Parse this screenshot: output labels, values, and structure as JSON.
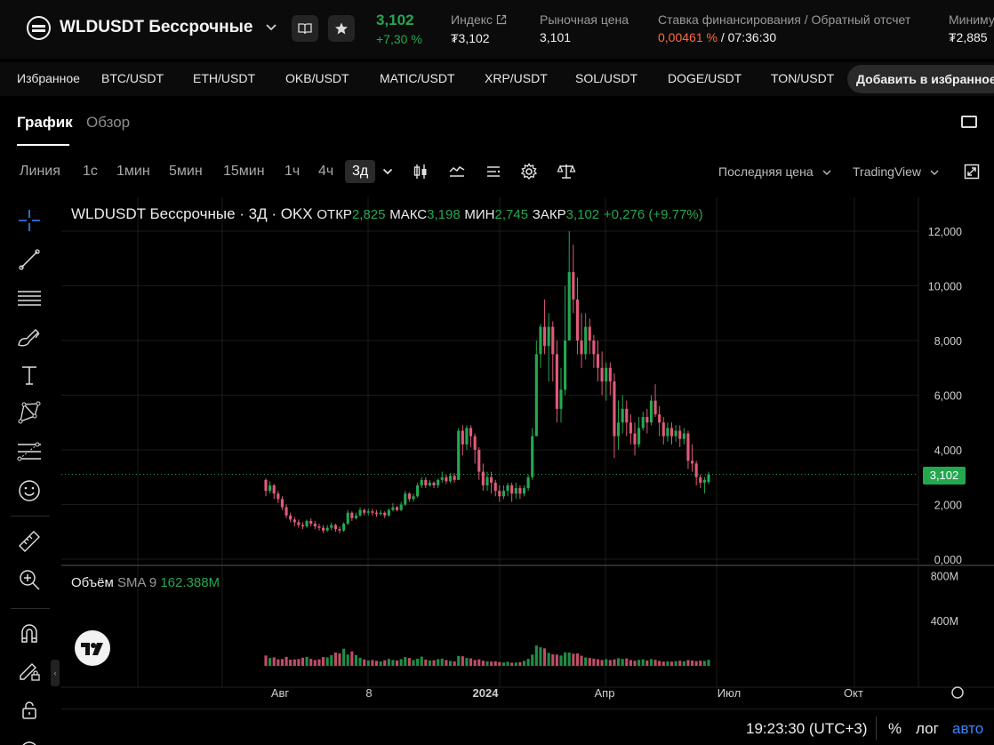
{
  "header": {
    "symbol": "WLDUSDT Бессрочные",
    "price": "3,102",
    "change": "+7,30 %",
    "index_label": "Индекс",
    "index_value": "₮3,102",
    "mark_label": "Рыночная цена",
    "mark_value": "3,101",
    "funding_label": "Ставка финансирования / Обратный отсчет",
    "funding_rate": "0,00461 %",
    "funding_sep": " / ",
    "funding_countdown": "07:36:30",
    "min_label": "Миниму",
    "min_value": "₮2,885"
  },
  "favorites": {
    "label": "Избранное",
    "items": [
      "BTC/USDT",
      "ETH/USDT",
      "OKB/USDT",
      "MATIC/USDT",
      "XRP/USDT",
      "SOL/USDT",
      "DOGE/USDT",
      "TON/USDT"
    ],
    "add_label": "Добавить в избранное"
  },
  "tabs": {
    "chart": "График",
    "overview": "Обзор"
  },
  "toolbar": {
    "timeframes": [
      "Линия",
      "1с",
      "1мин",
      "5мин",
      "15мин",
      "1ч",
      "4ч"
    ],
    "active_timeframe": "3д",
    "price_type": "Последняя цена",
    "source": "TradingView"
  },
  "legend": {
    "title": "WLDUSDT Бессрочные · 3Д · OKX",
    "open_label": "ОТКР",
    "open": "2,825",
    "high_label": "МАКС",
    "high": "3,198",
    "low_label": "МИН",
    "low": "2,745",
    "close_label": "ЗАКР",
    "close": "3,102",
    "change": "+0,276 (+9.77%)"
  },
  "volume": {
    "title": "Объём",
    "sma": "SMA 9",
    "value": "162.388M"
  },
  "axes": {
    "price_ticks": [
      "12,000",
      "10,000",
      "8,000",
      "6,000",
      "4,000",
      "2,000",
      "0,000"
    ],
    "volume_ticks": [
      "800M",
      "400M"
    ],
    "time_ticks": [
      "Авг",
      "8",
      "2024",
      "Апр",
      "Июл",
      "Окт"
    ],
    "last_price": "3,102"
  },
  "footer": {
    "time": "19:23:30 (UTC+3)",
    "percent": "%",
    "log": "лог",
    "auto": "авто"
  },
  "colors": {
    "up": "#25a750",
    "down": "#e05a7a",
    "accent": "#3a86ff",
    "funding": "#ff6a3d"
  },
  "chart_data": {
    "type": "candlestick",
    "title": "WLDUSDT Бессрочные · 3Д · OKX",
    "ylim": [
      0,
      12
    ],
    "volume_ylim": [
      0,
      1000
    ],
    "candles": [
      [
        2.9,
        2.5,
        2.95,
        2.3,
        92
      ],
      [
        2.5,
        2.7,
        2.85,
        2.4,
        70
      ],
      [
        2.7,
        2.4,
        2.75,
        2.2,
        75
      ],
      [
        2.4,
        2.2,
        2.5,
        2.05,
        58
      ],
      [
        2.2,
        1.9,
        2.3,
        1.8,
        60
      ],
      [
        1.9,
        1.6,
        2.0,
        1.5,
        80
      ],
      [
        1.6,
        1.45,
        1.7,
        1.35,
        55
      ],
      [
        1.45,
        1.35,
        1.55,
        1.2,
        57
      ],
      [
        1.35,
        1.25,
        1.45,
        1.15,
        60
      ],
      [
        1.25,
        1.2,
        1.35,
        1.1,
        72
      ],
      [
        1.2,
        1.4,
        1.45,
        1.15,
        80
      ],
      [
        1.4,
        1.3,
        1.5,
        1.2,
        62
      ],
      [
        1.3,
        1.2,
        1.4,
        1.1,
        52
      ],
      [
        1.2,
        1.15,
        1.3,
        1.05,
        58
      ],
      [
        1.15,
        1.05,
        1.25,
        0.95,
        78
      ],
      [
        1.05,
        1.15,
        1.25,
        1.0,
        75
      ],
      [
        1.15,
        1.25,
        1.35,
        1.05,
        95
      ],
      [
        1.25,
        1.1,
        1.3,
        1.0,
        118
      ],
      [
        1.1,
        1.05,
        1.2,
        0.95,
        110
      ],
      [
        1.05,
        1.3,
        1.35,
        1.0,
        152
      ],
      [
        1.3,
        1.7,
        1.8,
        1.25,
        100
      ],
      [
        1.7,
        1.5,
        1.75,
        1.4,
        128
      ],
      [
        1.5,
        1.6,
        1.7,
        1.45,
        96
      ],
      [
        1.6,
        1.8,
        1.9,
        1.55,
        72
      ],
      [
        1.8,
        1.7,
        1.85,
        1.6,
        57
      ],
      [
        1.7,
        1.75,
        1.85,
        1.6,
        48
      ],
      [
        1.75,
        1.7,
        1.85,
        1.6,
        52
      ],
      [
        1.7,
        1.65,
        1.8,
        1.55,
        45
      ],
      [
        1.65,
        1.7,
        1.8,
        1.6,
        40
      ],
      [
        1.7,
        1.6,
        1.75,
        1.5,
        50
      ],
      [
        1.6,
        1.8,
        1.85,
        1.55,
        62
      ],
      [
        1.8,
        1.9,
        2.05,
        1.75,
        52
      ],
      [
        1.9,
        1.8,
        1.95,
        1.75,
        48
      ],
      [
        1.8,
        2.0,
        2.1,
        1.75,
        60
      ],
      [
        2.0,
        2.4,
        2.5,
        1.95,
        78
      ],
      [
        2.4,
        2.2,
        2.45,
        2.1,
        70
      ],
      [
        2.2,
        2.3,
        2.4,
        2.1,
        52
      ],
      [
        2.3,
        2.7,
        2.8,
        2.25,
        64
      ],
      [
        2.7,
        2.9,
        3.0,
        2.6,
        82
      ],
      [
        2.9,
        2.7,
        3.0,
        2.6,
        55
      ],
      [
        2.7,
        2.8,
        2.9,
        2.65,
        48
      ],
      [
        2.8,
        2.7,
        2.85,
        2.6,
        50
      ],
      [
        2.7,
        2.9,
        2.95,
        2.6,
        60
      ],
      [
        2.9,
        3.0,
        3.2,
        2.8,
        64
      ],
      [
        3.0,
        2.85,
        3.1,
        2.75,
        52
      ],
      [
        2.85,
        3.05,
        3.15,
        2.8,
        45
      ],
      [
        3.05,
        2.9,
        3.15,
        2.8,
        40
      ],
      [
        2.9,
        4.7,
        4.8,
        2.9,
        88
      ],
      [
        4.7,
        4.2,
        4.9,
        3.8,
        85
      ],
      [
        4.2,
        4.8,
        4.9,
        4.0,
        70
      ],
      [
        4.8,
        4.5,
        4.9,
        4.1,
        66
      ],
      [
        4.5,
        4.0,
        4.6,
        3.5,
        52
      ],
      [
        4.0,
        3.2,
        4.1,
        2.9,
        58
      ],
      [
        3.2,
        2.7,
        3.5,
        2.5,
        46
      ],
      [
        2.7,
        3.0,
        3.2,
        2.5,
        40
      ],
      [
        3.0,
        2.8,
        3.2,
        2.4,
        38
      ],
      [
        2.8,
        2.5,
        2.9,
        2.3,
        40
      ],
      [
        2.5,
        2.3,
        2.7,
        2.1,
        34
      ],
      [
        2.3,
        2.5,
        2.7,
        2.2,
        30
      ],
      [
        2.5,
        2.7,
        2.8,
        2.3,
        36
      ],
      [
        2.7,
        2.4,
        2.8,
        2.1,
        28
      ],
      [
        2.4,
        2.6,
        2.8,
        2.2,
        30
      ],
      [
        2.6,
        2.4,
        2.7,
        2.2,
        34
      ],
      [
        2.4,
        2.6,
        2.7,
        2.3,
        45
      ],
      [
        2.6,
        3.0,
        3.1,
        2.5,
        62
      ],
      [
        3.0,
        4.5,
        4.8,
        2.9,
        100
      ],
      [
        4.5,
        7.5,
        8.0,
        4.5,
        180
      ],
      [
        7.5,
        8.5,
        8.6,
        7.0,
        165
      ],
      [
        8.5,
        7.8,
        9.5,
        7.5,
        155
      ],
      [
        7.8,
        8.5,
        9.0,
        6.5,
        115
      ],
      [
        8.5,
        7.5,
        8.7,
        6.5,
        102
      ],
      [
        7.5,
        5.5,
        8.0,
        5.0,
        100
      ],
      [
        5.5,
        6.2,
        7.0,
        5.0,
        92
      ],
      [
        6.2,
        8.0,
        10.0,
        6.0,
        120
      ],
      [
        8.0,
        10.5,
        12.0,
        8.0,
        118
      ],
      [
        10.5,
        9.5,
        11.5,
        9.0,
        108
      ],
      [
        9.5,
        8.0,
        10.3,
        7.5,
        110
      ],
      [
        8.0,
        7.5,
        9.0,
        7.0,
        90
      ],
      [
        7.5,
        8.5,
        9.0,
        7.3,
        75
      ],
      [
        8.5,
        8.0,
        8.8,
        7.5,
        70
      ],
      [
        8.0,
        7.5,
        8.2,
        7.0,
        64
      ],
      [
        7.5,
        7.0,
        8.0,
        6.5,
        58
      ],
      [
        7.0,
        6.5,
        7.6,
        6.0,
        52
      ],
      [
        6.5,
        7.0,
        7.2,
        5.8,
        60
      ],
      [
        7.0,
        6.5,
        7.2,
        6.0,
        52
      ],
      [
        6.5,
        4.5,
        6.8,
        3.7,
        58
      ],
      [
        4.5,
        5.0,
        5.8,
        4.0,
        68
      ],
      [
        5.0,
        5.5,
        6.0,
        4.6,
        62
      ],
      [
        5.5,
        5.0,
        5.8,
        4.5,
        66
      ],
      [
        5.0,
        4.6,
        5.3,
        4.2,
        52
      ],
      [
        4.6,
        4.2,
        5.0,
        3.8,
        46
      ],
      [
        4.2,
        4.8,
        5.2,
        4.1,
        54
      ],
      [
        4.8,
        5.2,
        5.4,
        4.7,
        58
      ],
      [
        5.2,
        5.0,
        5.5,
        4.6,
        48
      ],
      [
        5.0,
        5.8,
        6.0,
        4.9,
        60
      ],
      [
        5.8,
        5.3,
        6.4,
        5.2,
        54
      ],
      [
        5.3,
        5.0,
        5.6,
        4.5,
        44
      ],
      [
        5.0,
        4.5,
        5.2,
        4.2,
        38
      ],
      [
        4.5,
        4.8,
        5.0,
        4.3,
        40
      ],
      [
        4.8,
        4.5,
        5.0,
        4.2,
        38
      ],
      [
        4.5,
        4.7,
        4.9,
        4.3,
        42
      ],
      [
        4.7,
        4.4,
        4.9,
        4.1,
        46
      ],
      [
        4.4,
        4.6,
        4.8,
        4.2,
        40
      ],
      [
        4.6,
        3.6,
        4.7,
        3.3,
        52
      ],
      [
        3.6,
        3.5,
        4.2,
        3.2,
        48
      ],
      [
        3.5,
        3.0,
        3.6,
        2.7,
        42
      ],
      [
        3.0,
        2.8,
        3.1,
        2.6,
        46
      ],
      [
        2.8,
        2.9,
        3.0,
        2.4,
        44
      ],
      [
        2.825,
        3.102,
        3.198,
        2.745,
        54
      ]
    ]
  }
}
